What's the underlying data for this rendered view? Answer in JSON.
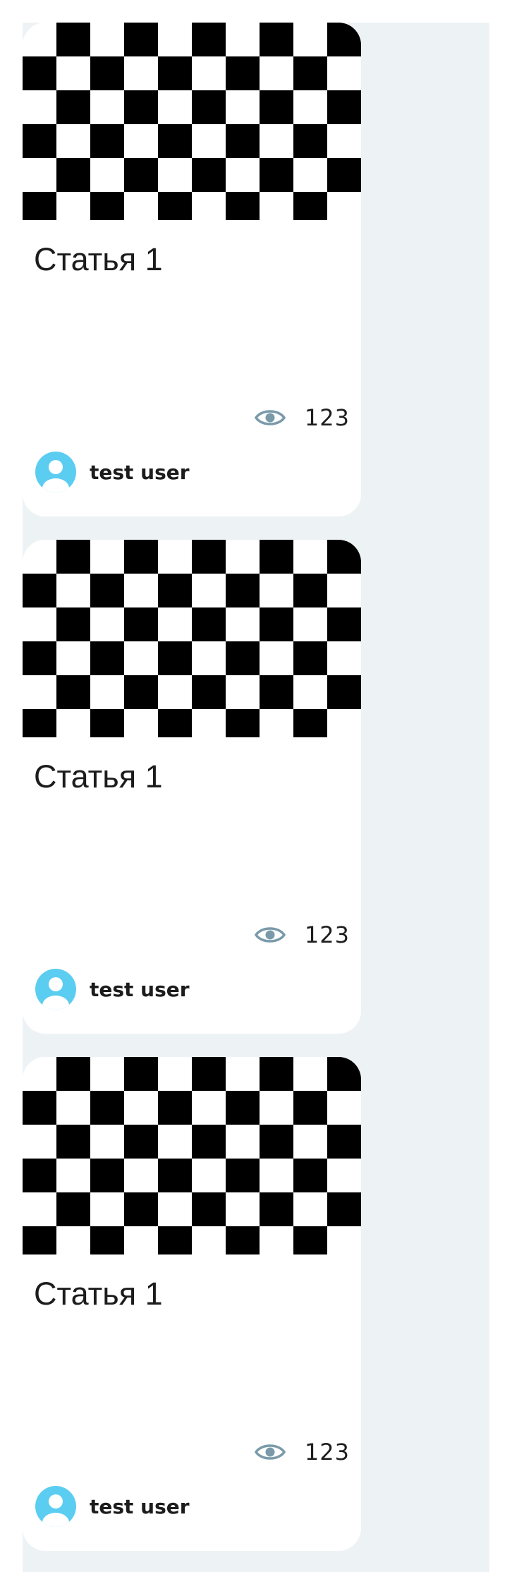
{
  "articles": [
    {
      "title": "Статья 1",
      "views": "123",
      "author": "test user",
      "image_icon": "checkerboard-placeholder",
      "views_icon": "eye-icon",
      "avatar_icon": "user-avatar-icon"
    },
    {
      "title": "Статья 1",
      "views": "123",
      "author": "test user",
      "image_icon": "checkerboard-placeholder",
      "views_icon": "eye-icon",
      "avatar_icon": "user-avatar-icon"
    },
    {
      "title": "Статья 1",
      "views": "123",
      "author": "test user",
      "image_icon": "checkerboard-placeholder",
      "views_icon": "eye-icon",
      "avatar_icon": "user-avatar-icon"
    }
  ],
  "colors": {
    "list_background": "#edf2f5",
    "card_background": "#ffffff",
    "eye_icon": "#7a9aaa",
    "avatar": "#5bcdf1"
  }
}
